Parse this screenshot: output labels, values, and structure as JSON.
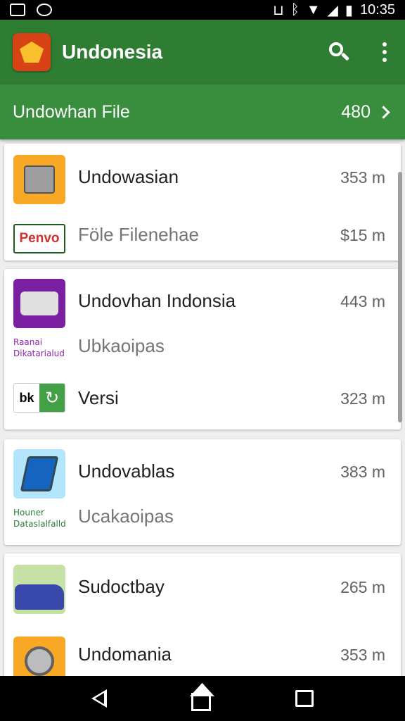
{
  "status": {
    "time": "10:35"
  },
  "app": {
    "title": "Undonesia"
  },
  "subbar": {
    "label": "Undowhan File",
    "count": "480"
  },
  "cards": [
    {
      "rows": [
        {
          "title": "Undowasian",
          "size": "353 m",
          "icon": "safe-app-icon"
        },
        {
          "title": "Föle Filenehae",
          "size": "$15 m",
          "icon": "lenovo-logo-icon",
          "logo_text": "Penvo"
        }
      ]
    },
    {
      "rows": [
        {
          "title": "Undovhan Indonsia",
          "size": "443 m",
          "icon": "projector-app-icon"
        },
        {
          "title": "Ubkaoipas",
          "size": "",
          "icon": "caption-text",
          "caption": [
            "Raanai",
            "Dikatarialud"
          ]
        },
        {
          "title": "Versi",
          "size": "323 m",
          "icon": "versi-app-icon",
          "badge": "bk"
        }
      ]
    },
    {
      "rows": [
        {
          "title": "Undovablas",
          "size": "383 m",
          "icon": "tablet-app-icon"
        },
        {
          "title": "Ucakaoipas",
          "size": "",
          "icon": "caption-text",
          "caption": [
            "Houner",
            "Dataslalfalld"
          ]
        }
      ]
    },
    {
      "rows": [
        {
          "title": "Sudoctbay",
          "size": "265 m",
          "icon": "car-app-icon"
        },
        {
          "title": "Undomania",
          "size": "353 m",
          "icon": "disc-app-icon"
        }
      ]
    }
  ]
}
